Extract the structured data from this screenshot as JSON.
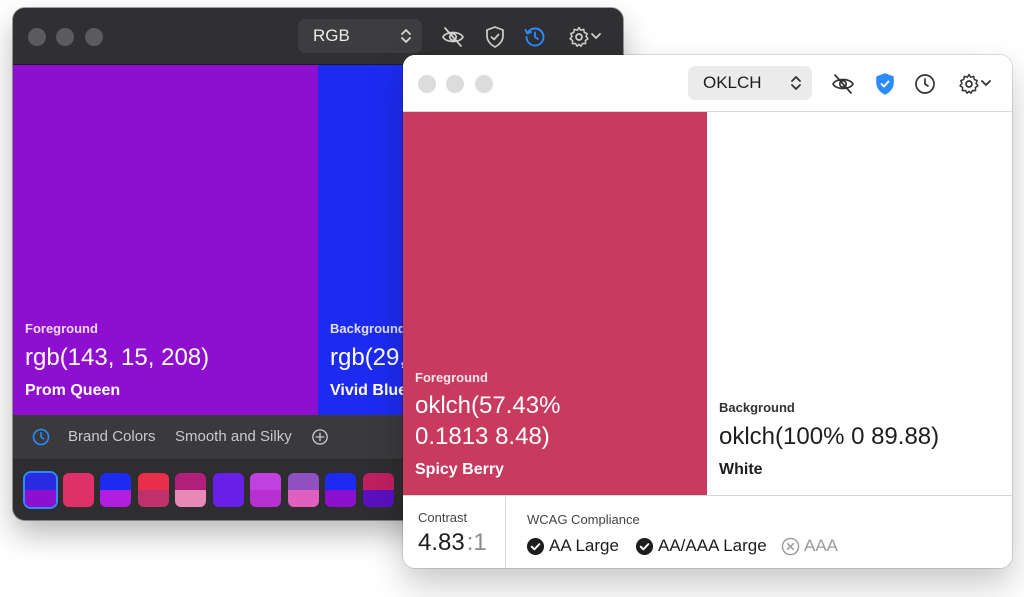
{
  "back_window": {
    "format": "RGB",
    "foreground": {
      "label": "Foreground",
      "value": "rgb(143, 15, 208)",
      "name": "Prom Queen",
      "color": "#8f0fd0"
    },
    "background": {
      "label": "Background",
      "value": "rgb(29, ",
      "name": "Vivid Blue",
      "color": "#1d2bf0"
    },
    "palette_tabs": [
      "Brand Colors",
      "Smooth and Silky"
    ],
    "palette_chips": [
      {
        "top": "#2a2ae0",
        "bottom": "#8f0fd0"
      },
      {
        "top": "#e0306a",
        "bottom": "#e0306a"
      },
      {
        "top": "#1d2bf0",
        "bottom": "#b01ee0"
      },
      {
        "top": "#e8304a",
        "bottom": "#c0306a"
      },
      {
        "top": "#b0207a",
        "bottom": "#e88ab8"
      },
      {
        "top": "#6a1fe8",
        "bottom": "#6a1fe8"
      },
      {
        "top": "#c040e0",
        "bottom": "#b830d0"
      },
      {
        "top": "#8f50c0",
        "bottom": "#e060c0"
      },
      {
        "top": "#1d2bf0",
        "bottom": "#8f0fd0"
      },
      {
        "top": "#c02060",
        "bottom": "#5a10c0"
      }
    ]
  },
  "front_window": {
    "format": "OKLCH",
    "foreground": {
      "label": "Foreground",
      "value_line1": "oklch(57.43%",
      "value_line2": "0.1813 8.48)",
      "name": "Spicy Berry",
      "color": "#c93a5f"
    },
    "background": {
      "label": "Background",
      "value": "oklch(100% 0 89.88)",
      "name": "White",
      "color": "#ffffff"
    },
    "contrast": {
      "label": "Contrast",
      "ratio": "4.83",
      "suffix": ":1"
    },
    "wcag": {
      "label": "WCAG Compliance",
      "levels": [
        {
          "name": "AA Large",
          "pass": true
        },
        {
          "name": "AA/AAA Large",
          "pass": true
        },
        {
          "name": "AAA",
          "pass": false
        }
      ]
    }
  },
  "accent_color": "#2b8bff"
}
